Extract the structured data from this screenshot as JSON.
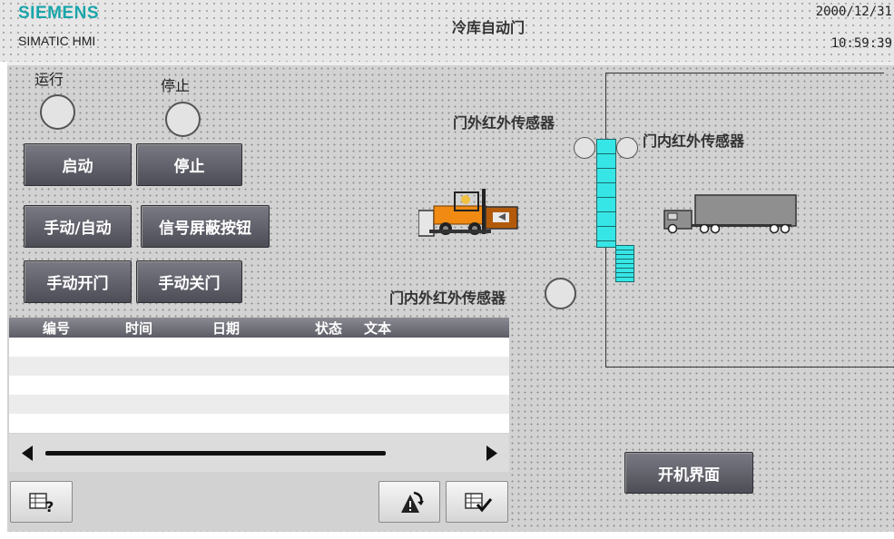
{
  "header": {
    "brand": "SIEMENS",
    "model": "SIMATIC HMI",
    "title": "冷库自动门",
    "date": "2000/12/31",
    "time": "10:59:39"
  },
  "status": {
    "run_label": "运行",
    "stop_label": "停止"
  },
  "buttons": {
    "start": "启动",
    "stop": "停止",
    "manual_auto": "手动/自动",
    "signal_mask": "信号屏蔽按钮",
    "manual_open": "手动开门",
    "manual_close": "手动关门",
    "startup_screen": "开机界面"
  },
  "sensors": {
    "outer": "门外红外传感器",
    "inner": "门内红外传感器",
    "inner_outer": "门内外红外传感器"
  },
  "alarm_view": {
    "columns": [
      "编号",
      "时间",
      "日期",
      "状态",
      "文本"
    ],
    "rows": []
  },
  "colors": {
    "brand": "#1aa5aa",
    "door": "#36e6e6",
    "button": "#5c5c66"
  },
  "icons": [
    "forklift-icon",
    "truck-icon",
    "arrow-left-icon",
    "arrow-right-icon",
    "help-icon",
    "acknowledge-icon",
    "edit-list-icon"
  ]
}
